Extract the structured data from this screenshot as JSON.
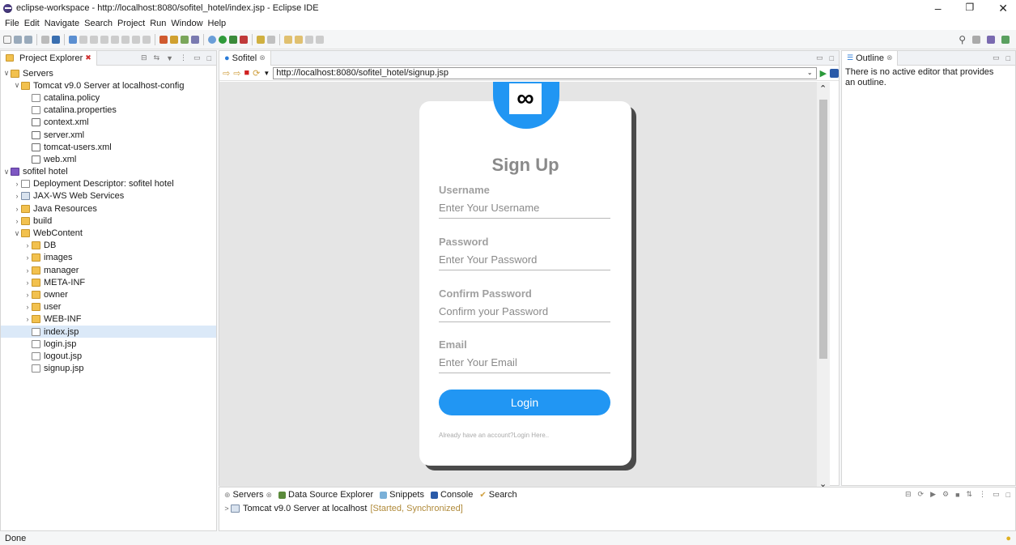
{
  "window": {
    "title": "eclipse-workspace - http://localhost:8080/sofitel_hotel/index.jsp - Eclipse IDE"
  },
  "menu": [
    "File",
    "Edit",
    "Navigate",
    "Search",
    "Project",
    "Run",
    "Window",
    "Help"
  ],
  "explorer": {
    "tab": "Project Explorer",
    "rows": [
      {
        "label": "Servers",
        "depth": 0,
        "twisty": "v",
        "icon": "folder"
      },
      {
        "label": "Tomcat v9.0 Server at localhost-config",
        "depth": 1,
        "twisty": "v",
        "icon": "folder"
      },
      {
        "label": "catalina.policy",
        "depth": 2,
        "twisty": "",
        "icon": "file"
      },
      {
        "label": "catalina.properties",
        "depth": 2,
        "twisty": "",
        "icon": "file"
      },
      {
        "label": "context.xml",
        "depth": 2,
        "twisty": "",
        "icon": "xml"
      },
      {
        "label": "server.xml",
        "depth": 2,
        "twisty": "",
        "icon": "xml"
      },
      {
        "label": "tomcat-users.xml",
        "depth": 2,
        "twisty": "",
        "icon": "xml"
      },
      {
        "label": "web.xml",
        "depth": 2,
        "twisty": "",
        "icon": "xml"
      },
      {
        "label": "sofitel hotel",
        "depth": 0,
        "twisty": "v",
        "icon": "proj"
      },
      {
        "label": "Deployment Descriptor: sofitel hotel",
        "depth": 1,
        "twisty": ">",
        "icon": "file"
      },
      {
        "label": "JAX-WS Web Services",
        "depth": 1,
        "twisty": ">",
        "icon": "srv"
      },
      {
        "label": "Java Resources",
        "depth": 1,
        "twisty": ">",
        "icon": "folder"
      },
      {
        "label": "build",
        "depth": 1,
        "twisty": ">",
        "icon": "folder"
      },
      {
        "label": "WebContent",
        "depth": 1,
        "twisty": "v",
        "icon": "folder"
      },
      {
        "label": "DB",
        "depth": 2,
        "twisty": ">",
        "icon": "folder"
      },
      {
        "label": "images",
        "depth": 2,
        "twisty": ">",
        "icon": "folder"
      },
      {
        "label": "manager",
        "depth": 2,
        "twisty": ">",
        "icon": "folder"
      },
      {
        "label": "META-INF",
        "depth": 2,
        "twisty": ">",
        "icon": "folder"
      },
      {
        "label": "owner",
        "depth": 2,
        "twisty": ">",
        "icon": "folder"
      },
      {
        "label": "user",
        "depth": 2,
        "twisty": ">",
        "icon": "folder"
      },
      {
        "label": "WEB-INF",
        "depth": 2,
        "twisty": ">",
        "icon": "folder"
      },
      {
        "label": "index.jsp",
        "depth": 2,
        "twisty": "",
        "icon": "file",
        "selected": true
      },
      {
        "label": "login.jsp",
        "depth": 2,
        "twisty": "",
        "icon": "file"
      },
      {
        "label": "logout.jsp",
        "depth": 2,
        "twisty": "",
        "icon": "file"
      },
      {
        "label": "signup.jsp",
        "depth": 2,
        "twisty": "",
        "icon": "file"
      }
    ]
  },
  "editor": {
    "tab": "Sofitel",
    "url": "http://localhost:8080/sofitel_hotel/signup.jsp"
  },
  "signup": {
    "title": "Sign Up",
    "username_label": "Username",
    "username_placeholder": "Enter Your Username",
    "password_label": "Password",
    "password_placeholder": "Enter Your Password",
    "confirm_label": "Confirm Password",
    "confirm_placeholder": "Confirm your Password",
    "email_label": "Email",
    "email_placeholder": "Enter Your Email",
    "button": "Login",
    "footer": "Already have an account?Login Here.."
  },
  "outline": {
    "tab": "Outline",
    "message": "There is no active editor that provides an outline."
  },
  "bottom": {
    "tabs": [
      "Servers",
      "Data Source Explorer",
      "Snippets",
      "Console",
      "Search"
    ],
    "server_name": "Tomcat v9.0 Server at localhost",
    "server_state": "[Started, Synchronized]"
  },
  "status": "Done"
}
